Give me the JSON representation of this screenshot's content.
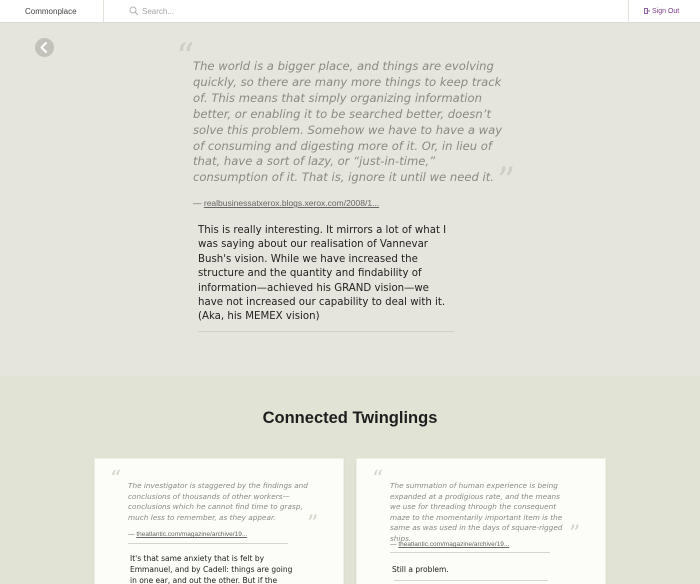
{
  "header": {
    "brand": "Commonplace",
    "search_placeholder": "Search...",
    "signout_label": "Sign Out"
  },
  "main": {
    "quote": "The world is a bigger place, and things are evolving quickly, so there are many more things to keep track of. This means that simply organizing information better, or enabling it to be searched better, doesn’t solve this problem. Somehow we have to have a way of consuming and digesting more of it. Or, in lieu of that, have a sort of lazy, or “just-in-time,” consumption of it. That is, ignore it until we need it.",
    "source_prefix": "—",
    "source_link": "realbusinessatxerox.blogs.xerox.com/2008/1...",
    "comment": "This is really interesting. It mirrors a lot of what I was saying about our realisation of Vannevar Bush's vision. While we have increased the structure and the quantity and findability of information—achieved his GRAND vision—we have not increased our capability to deal with it. (Aka, his MEMEX vision)"
  },
  "connected": {
    "title": "Connected Twinglings",
    "cards": [
      {
        "quote": "The investigator is staggered by the findings and conclusions of thousands of other workers—conclusions which he cannot find time to grasp, much less to remember, as they appear.",
        "source_prefix": "—",
        "source_link": "theatlantic.com/magazine/archive/19...",
        "comment": "It's that same anxiety that is felt by Emmanuel, and by Cadell: things are going in one ear, and out the other. But if the internet"
      },
      {
        "quote": "The summation of human experience is being expanded at a prodigious rate, and the means we use for threading through the consequent maze to the momentarily important item is the same as was used in the days of square-rigged ships.",
        "source_prefix": "—",
        "source_link": "theatlantic.com/magazine/archive/19...",
        "comment": "Still a problem."
      }
    ]
  },
  "colors": {
    "background": "#e6e5dd",
    "connected_background": "#e1e3d4",
    "signout": "#7b3d8b",
    "quote_text": "#8a8a84"
  },
  "icons": {
    "search": "search-icon",
    "back": "back-arrow-icon",
    "signout": "signout-icon",
    "quote_open": "open-quote-icon",
    "quote_close": "close-quote-icon"
  }
}
